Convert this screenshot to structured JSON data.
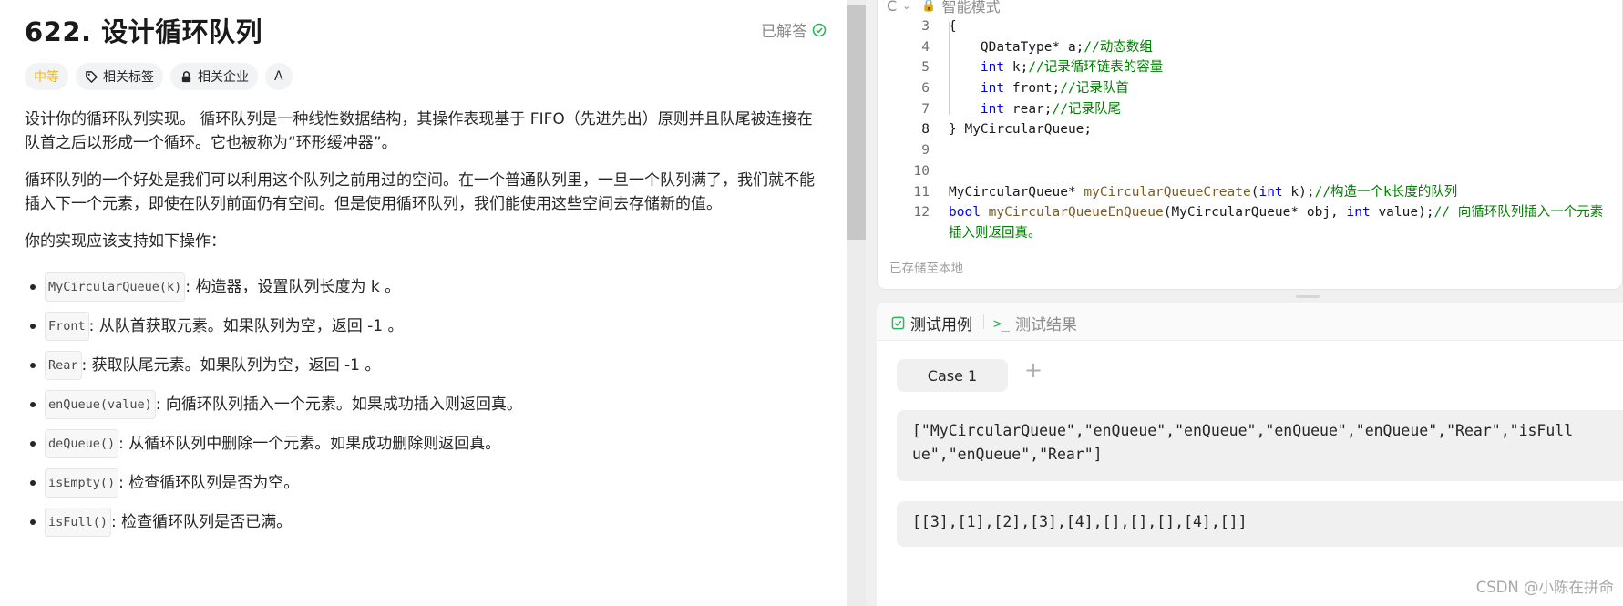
{
  "problem": {
    "title": "622. 设计循环队列",
    "status": "已解答",
    "tags": [
      "中等",
      "相关标签",
      "相关企业",
      "A"
    ],
    "paragraphs": [
      "设计你的循环队列实现。 循环队列是一种线性数据结构，其操作表现基于 FIFO（先进先出）原则并且队尾被连接在队首之后以形成一个循环。它也被称为“环形缓冲器”。",
      "循环队列的一个好处是我们可以利用这个队列之前用过的空间。在一个普通队列里，一旦一个队列满了，我们就不能插入下一个元素，即使在队列前面仍有空间。但是使用循环队列，我们能使用这些空间去存储新的值。",
      "你的实现应该支持如下操作："
    ],
    "operations": [
      {
        "code": "MyCircularQueue(k)",
        "text": ": 构造器，设置队列长度为 k 。"
      },
      {
        "code": "Front",
        "text": ": 从队首获取元素。如果队列为空，返回 -1 。"
      },
      {
        "code": "Rear",
        "text": ": 获取队尾元素。如果队列为空，返回 -1 。"
      },
      {
        "code": "enQueue(value)",
        "text": ": 向循环队列插入一个元素。如果成功插入则返回真。"
      },
      {
        "code": "deQueue()",
        "text": ": 从循环队列中删除一个元素。如果成功删除则返回真。"
      },
      {
        "code": "isEmpty()",
        "text": ": 检查循环队列是否为空。"
      },
      {
        "code": "isFull()",
        "text": ": 检查循环队列是否已满。"
      }
    ]
  },
  "editor": {
    "top_label": "智能模式",
    "top_prefix": "C",
    "lines": [
      {
        "n": "3",
        "parts": [
          {
            "t": "{",
            "c": ""
          }
        ]
      },
      {
        "n": "4",
        "parts": [
          {
            "t": "    QDataType* a;",
            "c": ""
          },
          {
            "t": "//动态数组",
            "c": "cm"
          }
        ]
      },
      {
        "n": "5",
        "parts": [
          {
            "t": "    ",
            "c": ""
          },
          {
            "t": "int",
            "c": "kw"
          },
          {
            "t": " k;",
            "c": ""
          },
          {
            "t": "//记录循环链表的容量",
            "c": "cm"
          }
        ]
      },
      {
        "n": "6",
        "parts": [
          {
            "t": "    ",
            "c": ""
          },
          {
            "t": "int",
            "c": "kw"
          },
          {
            "t": " front;",
            "c": ""
          },
          {
            "t": "//记录队首",
            "c": "cm"
          }
        ]
      },
      {
        "n": "7",
        "parts": [
          {
            "t": "    ",
            "c": ""
          },
          {
            "t": "int",
            "c": "kw"
          },
          {
            "t": " rear;",
            "c": ""
          },
          {
            "t": "//记录队尾",
            "c": "cm"
          }
        ]
      },
      {
        "n": "8",
        "active": true,
        "parts": [
          {
            "t": "} MyCircularQueue;",
            "c": ""
          }
        ]
      },
      {
        "n": "9",
        "parts": []
      },
      {
        "n": "10",
        "parts": []
      },
      {
        "n": "11",
        "parts": [
          {
            "t": "MyCircularQueue* ",
            "c": ""
          },
          {
            "t": "myCircularQueueCreate",
            "c": "fn"
          },
          {
            "t": "(",
            "c": ""
          },
          {
            "t": "int",
            "c": "kw"
          },
          {
            "t": " k);",
            "c": ""
          },
          {
            "t": "//构造一个k长度的队列",
            "c": "cm"
          }
        ]
      },
      {
        "n": "12",
        "parts": [
          {
            "t": "bool",
            "c": "kw"
          },
          {
            "t": " ",
            "c": ""
          },
          {
            "t": "myCircularQueueEnQueue",
            "c": "fn"
          },
          {
            "t": "(MyCircularQueue* obj, ",
            "c": ""
          },
          {
            "t": "int",
            "c": "kw"
          },
          {
            "t": " value);",
            "c": ""
          },
          {
            "t": "// 向循环队列插入一个元素",
            "c": "cm"
          }
        ]
      },
      {
        "n": "",
        "parts": [
          {
            "t": "插入则返回真。",
            "c": "cm"
          }
        ]
      }
    ],
    "saved_text": "已存储至本地"
  },
  "test_panel": {
    "tab_cases": "测试用例",
    "tab_results": "测试结果",
    "case_label": "Case 1",
    "add_symbol": "+",
    "input1": "[\"MyCircularQueue\",\"enQueue\",\"enQueue\",\"enQueue\",\"enQueue\",\"Rear\",\"isFull\nue\",\"enQueue\",\"Rear\"]",
    "input2": "[[3],[1],[2],[3],[4],[],[],[],[4],[]]"
  },
  "watermark": "CSDN @​​小陈在拼命​​",
  "colors": {
    "difficulty": "#ffb800",
    "solved": "#2db55d",
    "keyword": "#0000ff",
    "function": "#795e26",
    "comment": "#008000"
  }
}
